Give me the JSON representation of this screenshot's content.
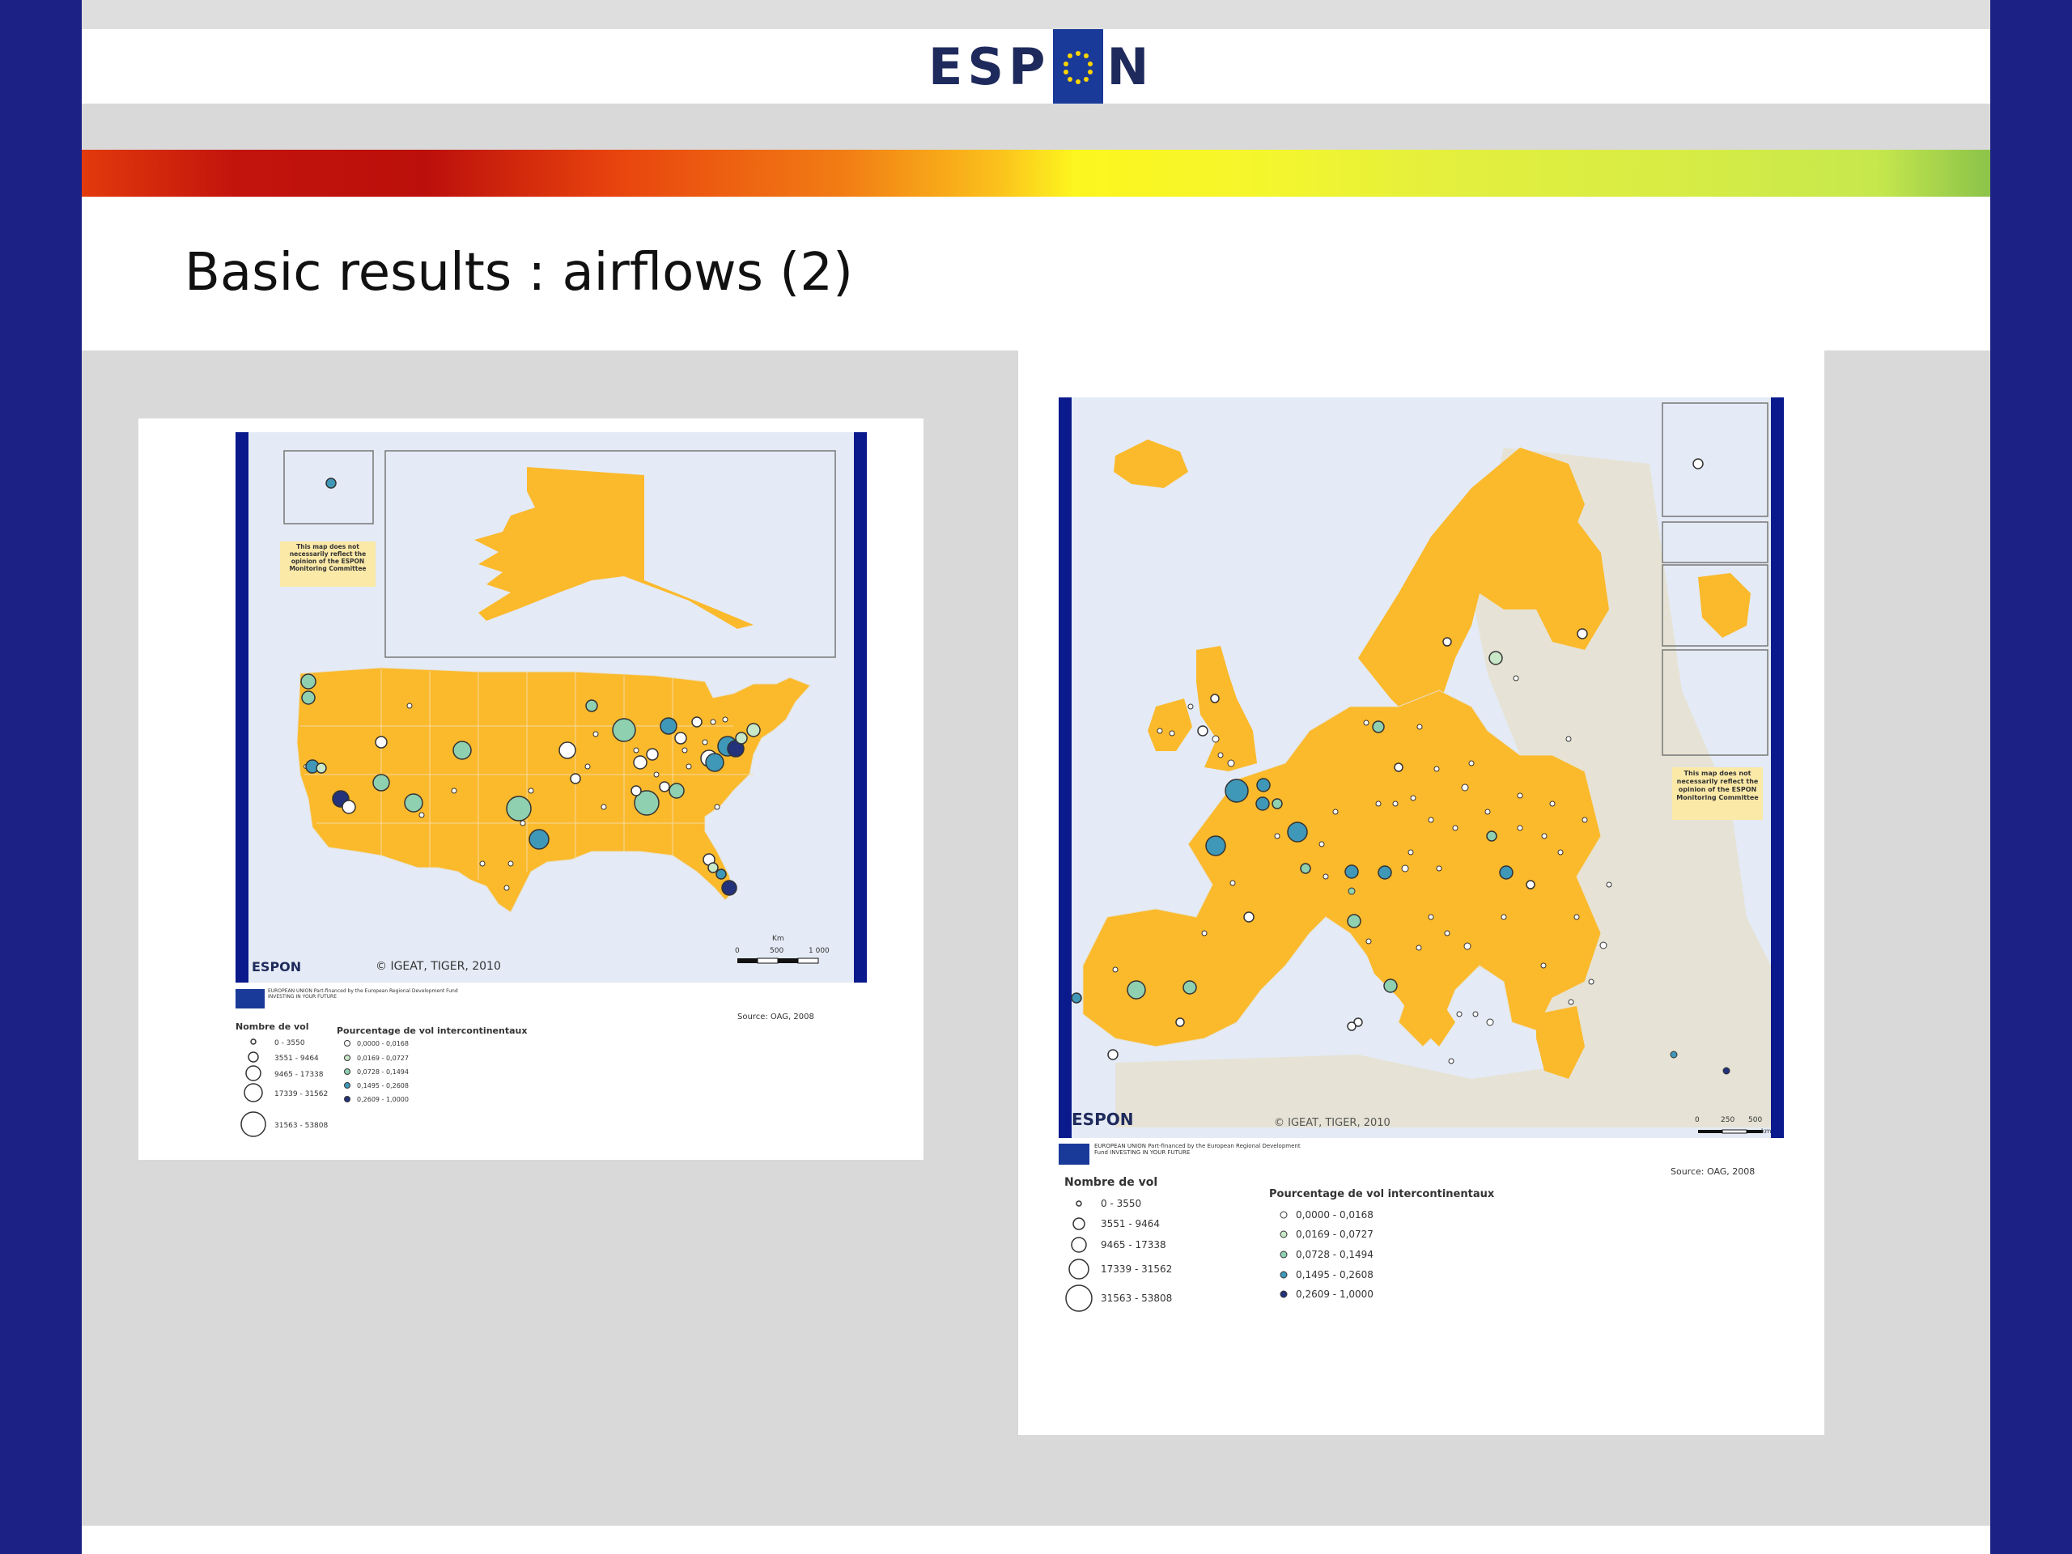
{
  "slide": {
    "logo_text": "ESPON",
    "title": "Basic results : airflows (2)"
  },
  "usa_map": {
    "disclaimer": "This map does not necessarily reflect the opinion of the ESPON Monitoring Committee",
    "copyright": "© IGEAT, TIGER, 2010",
    "scale_unit": "Km",
    "scale_ticks": [
      "0",
      "500",
      "1 000"
    ],
    "logo_text": "ESPON",
    "eu_text": "EUROPEAN UNION Part-financed by the European Regional Development Fund INVESTING IN YOUR FUTURE",
    "source": "Source: OAG, 2008",
    "legend_size_title": "Nombre de vol",
    "legend_sizes": [
      "0 - 3550",
      "3551 - 9464",
      "9465 - 17338",
      "17339 - 31562",
      "31563 - 53808"
    ],
    "legend_color_title": "Pourcentage de vol intercontinentaux",
    "legend_colors": [
      "0,0000 - 0,0168",
      "0,0169 - 0,0727",
      "0,0728 - 0,1494",
      "0,1495 - 0,2608",
      "0,2609 - 1,0000"
    ]
  },
  "europe_map": {
    "disclaimer": "This map does not necessarily reflect the opinion of the ESPON Monitoring Committee",
    "copyright": "© IGEAT, TIGER, 2010",
    "scale_unit": "km",
    "scale_ticks": [
      "0",
      "250",
      "500"
    ],
    "logo_text": "ESPON",
    "eu_text": "EUROPEAN UNION Part-financed by the European Regional Development Fund INVESTING IN YOUR FUTURE",
    "source": "Source: OAG, 2008",
    "legend_size_title": "Nombre de vol",
    "legend_sizes": [
      "0 - 3550",
      "3551 - 9464",
      "9465 - 17338",
      "17339 - 31562",
      "31563 - 53808"
    ],
    "legend_color_title": "Pourcentage de vol intercontinentaux",
    "legend_colors": [
      "0,0000 - 0,0168",
      "0,0169 - 0,0727",
      "0,0728 - 0,1494",
      "0,1495 - 0,2608",
      "0,2609 - 1,0000"
    ]
  },
  "colors": {
    "land": "#fbb92c",
    "sea": "#e4ebf6",
    "frame": "#0a1a8c",
    "class1": "#ffffff",
    "class2": "#c8e8c8",
    "class3": "#8fd0b0",
    "class4": "#3f98b8",
    "class5": "#23327a"
  }
}
